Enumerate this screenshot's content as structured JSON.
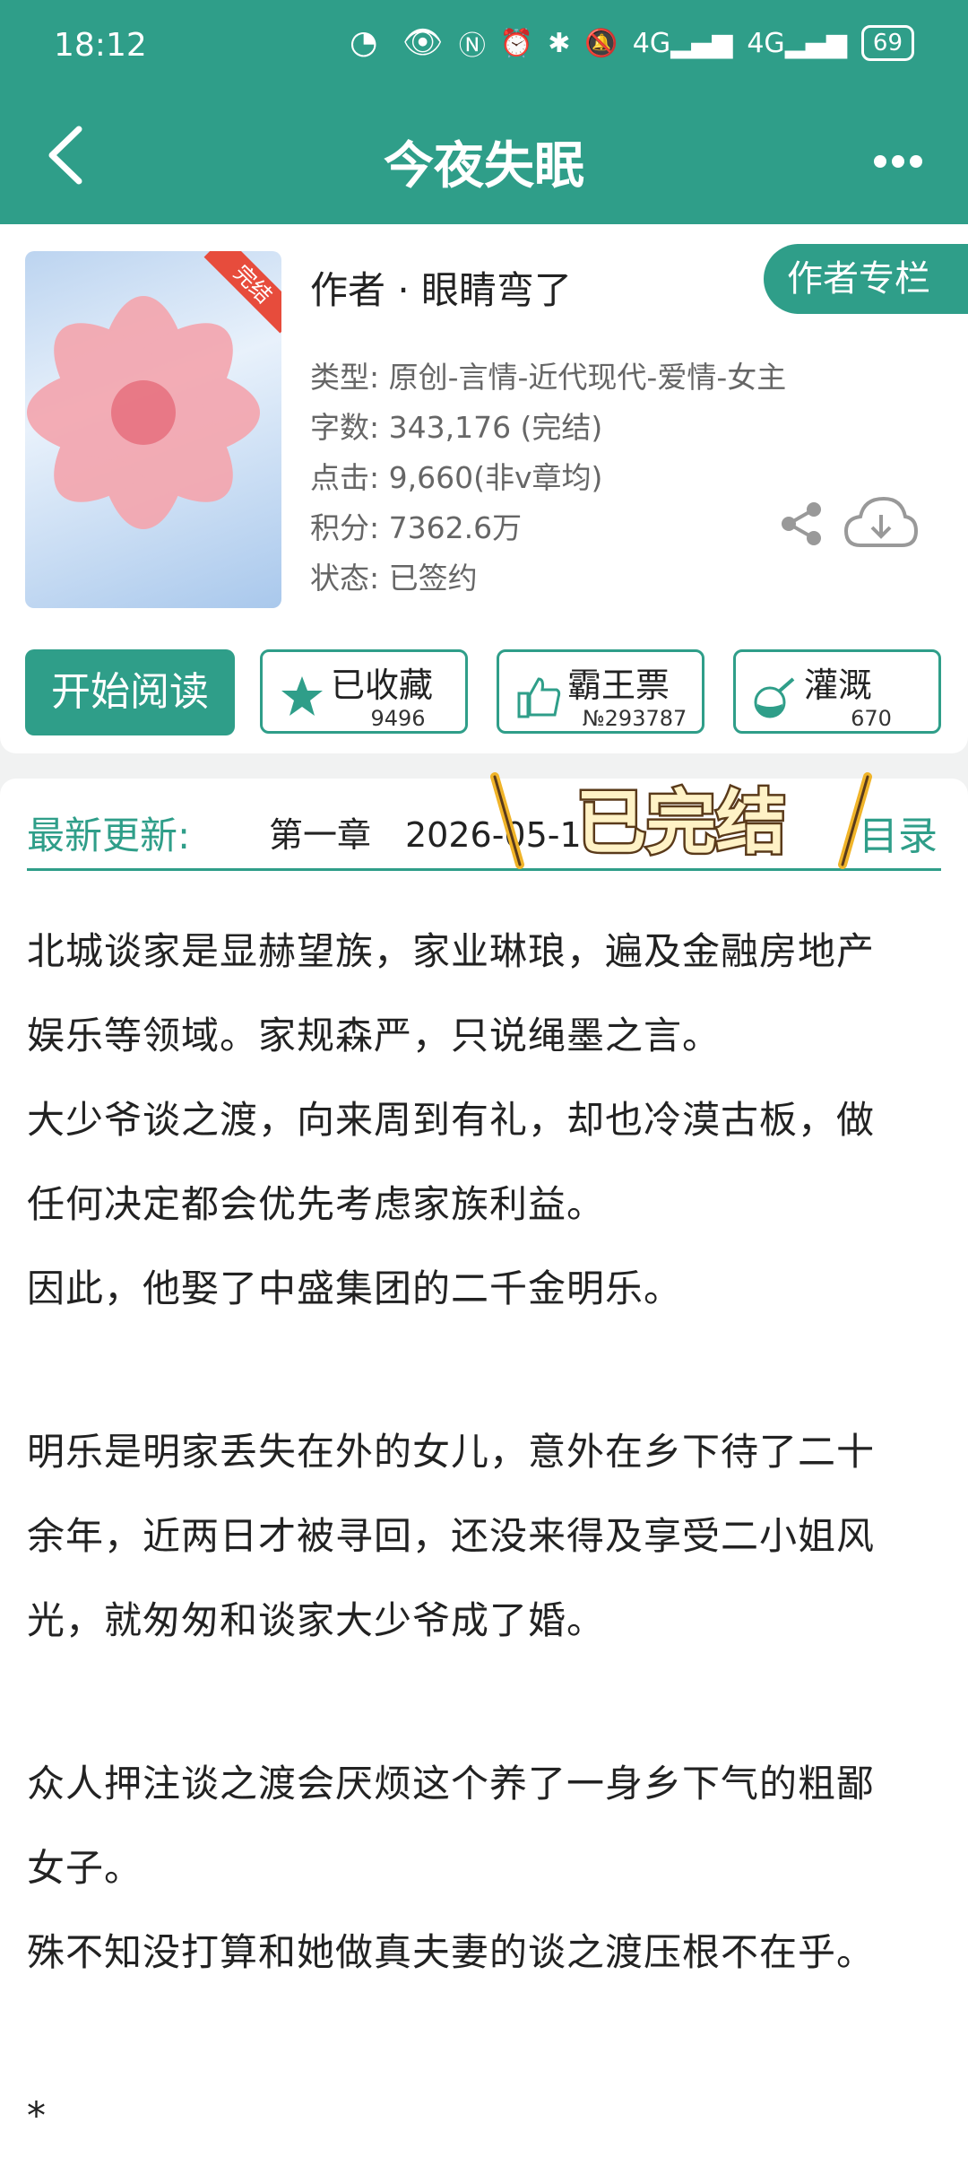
{
  "status_bar": {
    "time": "18:12",
    "network": "4G",
    "battery": "69"
  },
  "nav": {
    "title": "今夜失眠",
    "back_icon": "chevron-left-icon",
    "more_icon": "more-dots-icon"
  },
  "book": {
    "cover_badge": "完结",
    "author": "作者 · 眼睛弯了",
    "author_column": "作者专栏",
    "type": "类型: 原创-言情-近代现代-爱情-女主",
    "word_count": "字数: 343,176 (完结)",
    "clicks": "点击: 9,660(非v章均)",
    "score": "积分: 7362.6万",
    "status": "状态: 已签约"
  },
  "actions": {
    "read": "开始阅读",
    "collect": {
      "label": "已收藏",
      "count": "9496"
    },
    "ticket": {
      "label": "霸王票",
      "count": "№293787"
    },
    "water": {
      "label": "灌溉",
      "count": "670"
    }
  },
  "update": {
    "label": "最新更新:",
    "chapter": "第一章　2026-05-1",
    "directory": "目录",
    "sticker_text": "已完结"
  },
  "summary": [
    "北城谈家是显赫望族，家业琳琅，遍及金融房地产",
    "娱乐等领域。家规森严，只说绳墨之言。",
    "大少爷谈之渡，向来周到有礼，却也冷漠古板，做",
    "任何决定都会优先考虑家族利益。",
    "因此，他娶了中盛集团的二千金明乐。",
    "明乐是明家丢失在外的女儿，意外在乡下待了二十",
    "余年，近两日才被寻回，还没来得及享受二小姐风",
    "光，就匆匆和谈家大少爷成了婚。",
    "众人押注谈之渡会厌烦这个养了一身乡下气的粗鄙",
    "女子。",
    "殊不知没打算和她做真夫妻的谈之渡压根不在乎。",
    "*"
  ],
  "colors": {
    "accent": "#2f9e89",
    "background": "#f1f2f2"
  }
}
